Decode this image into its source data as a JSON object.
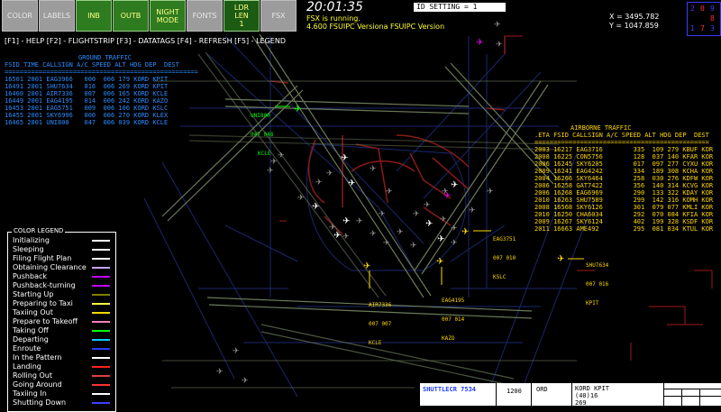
{
  "toolbar": {
    "buttons": [
      {
        "id": "color",
        "label": "COLOR",
        "style": "grey"
      },
      {
        "id": "labels",
        "label": "LABELS",
        "style": "grey"
      },
      {
        "id": "inb",
        "label": "INB",
        "style": "green"
      },
      {
        "id": "outb",
        "label": "OUTB",
        "style": "green"
      },
      {
        "id": "night",
        "label": "NIGHT MODE",
        "style": "green"
      },
      {
        "id": "fonts",
        "label": "FONTS",
        "style": "grey"
      },
      {
        "id": "ldr",
        "label": "LDR LEN 1",
        "style": "green dark"
      },
      {
        "id": "fsx",
        "label": "FSX",
        "style": "grey"
      }
    ]
  },
  "clock": "20:01:35",
  "status_lines": [
    "FSX is running.",
    "4.600 FSUIPC Versiona FSUIPC Version"
  ],
  "id_setting": "ID SETTING = 1",
  "coords": {
    "x": "X = 3495.782",
    "y": "Y = 1047.859"
  },
  "function_keys": "[F1] - HELP [F2] - FLIGHTSTRIP [F3] - DATATAGS [F4] - REFRESH [F5] - LEGEND",
  "radar_digits": [
    "2",
    "0",
    "9",
    "8",
    "1",
    "7",
    "3"
  ],
  "ground_traffic": {
    "title": "GROUND TRAFFIC",
    "header": "FSID TIME CALLSIGN A/C SPEED ALT HDG DEP  DEST",
    "separator": "===================================================",
    "rows": [
      "16501 2001 EAG3966   000  006 179 KORD KPIT",
      "16491 2001 SHU7634   016  006 269 KORD KPIT",
      "16460 2001 AIR7336   007  006 165 KORD KCLE",
      "16449 2001 EAG4195   014  006 242 KORD KAZO",
      "16453 2001 EAG5751   009  006 106 KORD KSLC",
      "16455 2001 SKY6996   000  006 270 KORD KLEX",
      "16465 2001 UNI800    047  006 039 KORD KCLE"
    ]
  },
  "airborne_traffic": {
    "title": "AIRBORNE TRAFFIC",
    "header": ".ETA FSID CALLSIGN A/C SPEED ALT HDG DEP  DEST",
    "separator": "==============================================",
    "rows": [
      "2003 16217 EAG3716        335  109 279 KBUF KOR",
      "2008 16225 CON5756        128  037 140 KFAR KOR",
      "2006 16245 SKY6205        017  097 277 CYXU KOR",
      "2009 16241 EAG4242        334  189 308 KCHA KOR",
      "2004 16266 SKY6464        258  030 276 KDFW KOR",
      "2006 16258 GAT7422        356  140 314 KCVG KOR",
      "2006 16268 EAG6969        290  133 322 KDAY KOR",
      "2010 16263 SHU7589        299  142 316 KOMH KOR",
      "2008 16568 SKY6126        301  079 077 KMLI KOR",
      "2010 16250 CHA6034        292  070 084 KFIA KOR",
      "2009 16267 SKY6124        402  199 328 KSDF KOR",
      "2011 16663 AME492         295  081 034 KTUL KOR"
    ]
  },
  "legend": {
    "title": "COLOR LEGEND",
    "items": [
      {
        "label": "Initializing",
        "color": "#ffffff"
      },
      {
        "label": "Sleeping",
        "color": "#ffffff"
      },
      {
        "label": "Filing Flight Plan",
        "color": "#ffffff"
      },
      {
        "label": "Obtaining Clearance",
        "color": "#c8a2ff"
      },
      {
        "label": "Pushback",
        "color": "#c000ff"
      },
      {
        "label": "Pushback-turning",
        "color": "#c000ff"
      },
      {
        "label": "Starting Up",
        "color": "#808000"
      },
      {
        "label": "Preparing to Taxi",
        "color": "#ffff40"
      },
      {
        "label": "Taxiing Out",
        "color": "#ffd700"
      },
      {
        "label": "Prepare to Takeoff",
        "color": "#ff80c0"
      },
      {
        "label": "Taking Off",
        "color": "#00ff00"
      },
      {
        "label": "Departing",
        "color": "#00c8ff"
      },
      {
        "label": "Enroute",
        "color": "#2040ff"
      },
      {
        "label": "In the Pattern",
        "color": "#ffffff"
      },
      {
        "label": "Landing",
        "color": "#ff2020"
      },
      {
        "label": "Rolling Out",
        "color": "#e04040"
      },
      {
        "label": "Going Around",
        "color": "#ff3030"
      },
      {
        "label": "Taxiing In",
        "color": "#ffffff"
      },
      {
        "label": "Shutting Down",
        "color": "#4040ff"
      }
    ]
  },
  "tags": [
    {
      "id": "uni800",
      "lines": [
        "UNI800",
        "047 048",
        "KCLE"
      ],
      "color": "#00ff00"
    },
    {
      "id": "eag3751",
      "lines": [
        "EAG3751",
        "007 010",
        "KSLC"
      ],
      "color": "#ffd700"
    },
    {
      "id": "shu7634",
      "lines": [
        "SHU7634",
        "007 016",
        "KPIT"
      ],
      "color": "#ffd700"
    },
    {
      "id": "air7336",
      "lines": [
        "AIR7336",
        "007 007",
        "KCLE"
      ],
      "color": "#ffd700"
    },
    {
      "id": "eag4195",
      "lines": [
        "EAG4195",
        "007 014",
        "KAZO"
      ],
      "color": "#ffd700"
    }
  ],
  "flight_strip": {
    "callsign": "SHUTTLECR 7534",
    "altitude": "1200",
    "origin": "ORD",
    "route": "KORD KPIT",
    "info1": "(40)16",
    "info2": "269"
  }
}
